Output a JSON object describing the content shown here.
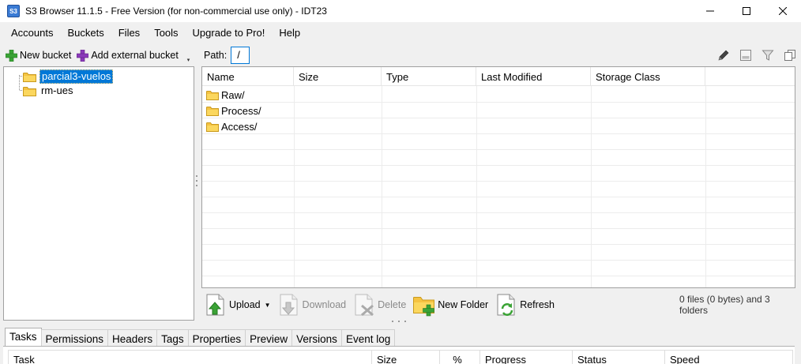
{
  "window": {
    "app_icon_text": "S3",
    "title": "S3 Browser 11.1.5 - Free Version (for non-commercial use only) - IDT23",
    "minimize_label": "—",
    "maximize_label": "☐",
    "close_label": "✕"
  },
  "menu": {
    "items": [
      "Accounts",
      "Buckets",
      "Files",
      "Tools",
      "Upgrade to Pro!",
      "Help"
    ]
  },
  "left_toolbar": {
    "new_bucket": "New bucket",
    "add_external_bucket": "Add external bucket",
    "collapse_arrow": "▾"
  },
  "buckets": [
    {
      "name": "parcial3-vuelos",
      "selected": true
    },
    {
      "name": "rm-ues",
      "selected": false
    }
  ],
  "path_bar": {
    "label": "Path:",
    "value": "/"
  },
  "right_tools": [
    "pencil-icon",
    "preview-pane-icon",
    "filter-icon",
    "copy-icon"
  ],
  "file_list": {
    "columns": [
      "Name",
      "Size",
      "Type",
      "Last Modified",
      "Storage Class"
    ],
    "rows": [
      {
        "name": "Raw/",
        "size": "",
        "type": "",
        "modified": "",
        "storage": ""
      },
      {
        "name": "Process/",
        "size": "",
        "type": "",
        "modified": "",
        "storage": ""
      },
      {
        "name": "Access/",
        "size": "",
        "type": "",
        "modified": "",
        "storage": ""
      }
    ]
  },
  "bottom_toolbar": {
    "upload": "Upload",
    "download": "Download",
    "delete": "Delete",
    "new_folder": "New Folder",
    "refresh": "Refresh",
    "summary": "0 files (0 bytes) and 3 folders"
  },
  "tabs": [
    "Tasks",
    "Permissions",
    "Headers",
    "Tags",
    "Properties",
    "Preview",
    "Versions",
    "Event log"
  ],
  "active_tab": "Tasks",
  "tasks_table": {
    "columns": [
      "Task",
      "Size",
      "%",
      "Progress",
      "Status",
      "Speed"
    ]
  },
  "colors": {
    "selection": "#0078d7",
    "folder_yellow": "#f5c342",
    "plus_green": "#3aa335",
    "plus_purple": "#8a3ab9"
  }
}
